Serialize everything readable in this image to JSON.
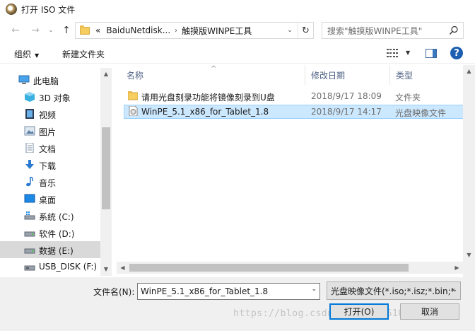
{
  "window": {
    "title": "打开 ISO 文件"
  },
  "nav": {
    "back": "←",
    "forward": "→",
    "recent": "⌄",
    "up": "↑",
    "breadcrumb_prefix": "«",
    "breadcrumb": [
      "BaiduNetdisk...",
      "触摸版WINPE工具"
    ],
    "breadcrumb_sep": "›",
    "address_dropdown": "⌄",
    "refresh": "↻",
    "search_placeholder": "搜索\"触摸版WINPE工具\""
  },
  "toolbar": {
    "organize": "组织",
    "caret": "▼",
    "new_folder": "新建文件夹",
    "help": "?"
  },
  "sidebar": {
    "items": [
      {
        "label": "此电脑",
        "icon": "computer-icon"
      },
      {
        "label": "3D 对象",
        "icon": "cube-icon"
      },
      {
        "label": "视频",
        "icon": "video-icon"
      },
      {
        "label": "图片",
        "icon": "picture-icon"
      },
      {
        "label": "文档",
        "icon": "document-icon"
      },
      {
        "label": "下载",
        "icon": "download-icon"
      },
      {
        "label": "音乐",
        "icon": "music-icon"
      },
      {
        "label": "桌面",
        "icon": "desktop-icon"
      },
      {
        "label": "系统 (C:)",
        "icon": "drive-c-icon"
      },
      {
        "label": "软件 (D:)",
        "icon": "drive-icon"
      },
      {
        "label": "数据 (E:)",
        "icon": "drive-icon"
      },
      {
        "label": "USB_DISK (F:)",
        "icon": "usb-drive-icon"
      }
    ]
  },
  "columns": {
    "name": "名称",
    "date": "修改日期",
    "type": "类型",
    "sort": "^"
  },
  "files": [
    {
      "name": "请用光盘刻录功能将镜像刻录到U盘",
      "date": "2018/9/17 18:09",
      "type": "文件夹",
      "icon": "folder-icon"
    },
    {
      "name": "WinPE_5.1_x86_for_Tablet_1.8",
      "date": "2018/9/17 14:17",
      "type": "光盘映像文件",
      "icon": "disc-image-icon"
    }
  ],
  "scroll": {
    "up": "▲",
    "down": "▼",
    "left": "◀",
    "right": "▶"
  },
  "bottom": {
    "filename_label": "文件名(N):",
    "filename_value": "WinPE_5.1_x86_for_Tablet_1.8",
    "filetype_value": "光盘映像文件(*.iso;*.isz;*.bin;*",
    "dropdown": "⌄",
    "open_label": "打开(O)",
    "cancel_label": "取消",
    "watermark": "https://blog.csdn.net/qq_36109988"
  }
}
